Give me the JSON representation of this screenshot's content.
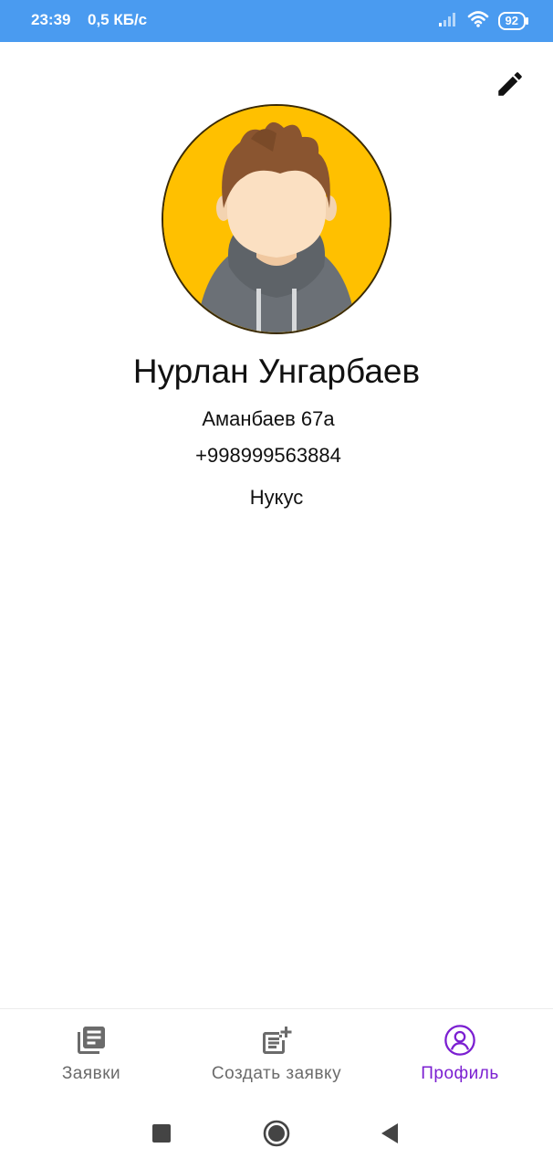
{
  "status_bar": {
    "time": "23:39",
    "speed": "0,5 КБ/с",
    "battery": "92"
  },
  "profile": {
    "name": "Нурлан Унгарбаев",
    "address": "Аманбаев 67а",
    "phone": "+998999563884",
    "city": "Нукус"
  },
  "bottom_nav": {
    "items": [
      {
        "label": "Заявки",
        "icon": "list-icon",
        "active": false
      },
      {
        "label": "Создать заявку",
        "icon": "note-add-icon",
        "active": false
      },
      {
        "label": "Профиль",
        "icon": "profile-icon",
        "active": true
      }
    ]
  },
  "colors": {
    "status_bar": "#4a9bf0",
    "accent": "#7b1fd1",
    "nav_inactive": "#6b6b6b",
    "avatar_bg": "#ffc000"
  },
  "icons": {
    "edit": "pencil-icon",
    "system_nav": [
      "recent-apps-icon",
      "home-icon",
      "back-icon"
    ]
  }
}
